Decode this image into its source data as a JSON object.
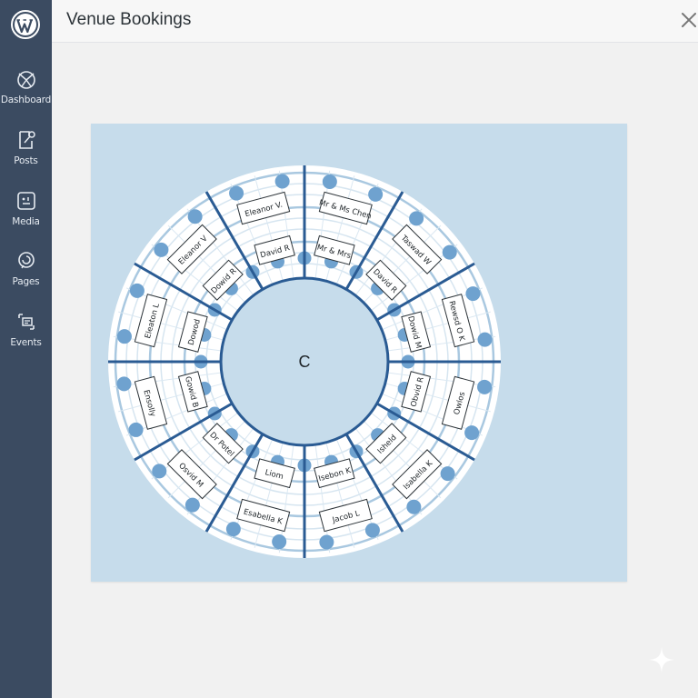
{
  "app": {
    "title": "Venue Bookings",
    "colors": {
      "sidebar": "#3b4b61",
      "accent": "#2a5b93",
      "panel": "#c6dceb"
    }
  },
  "sidebar": {
    "items": [
      {
        "label": "Dashboard",
        "icon": "dashboard-icon"
      },
      {
        "label": "Posts",
        "icon": "posts-icon"
      },
      {
        "label": "Media",
        "icon": "media-icon"
      },
      {
        "label": "Pages",
        "icon": "pages-icon"
      },
      {
        "label": "Events",
        "icon": "events-icon"
      }
    ]
  },
  "seating": {
    "center_label": "C",
    "inner_tags": [
      "Mr & Mrs",
      "David R",
      "Dowid M",
      "Obvid R",
      "Isheld",
      "Isebon K",
      "Liom",
      "Dr Potel",
      "Gowid B",
      "Dowod",
      "Dowid R",
      "David R"
    ],
    "outer_tags": [
      "Mr & Ms Chen",
      "Taswad W",
      "Rewsd O K",
      "Owlos",
      "Isabella K",
      "Jacob L",
      "Esabella K",
      "Osvid M",
      "Ensolly",
      "Eleaton L",
      "Eleanor V",
      "Eleanor V."
    ]
  }
}
